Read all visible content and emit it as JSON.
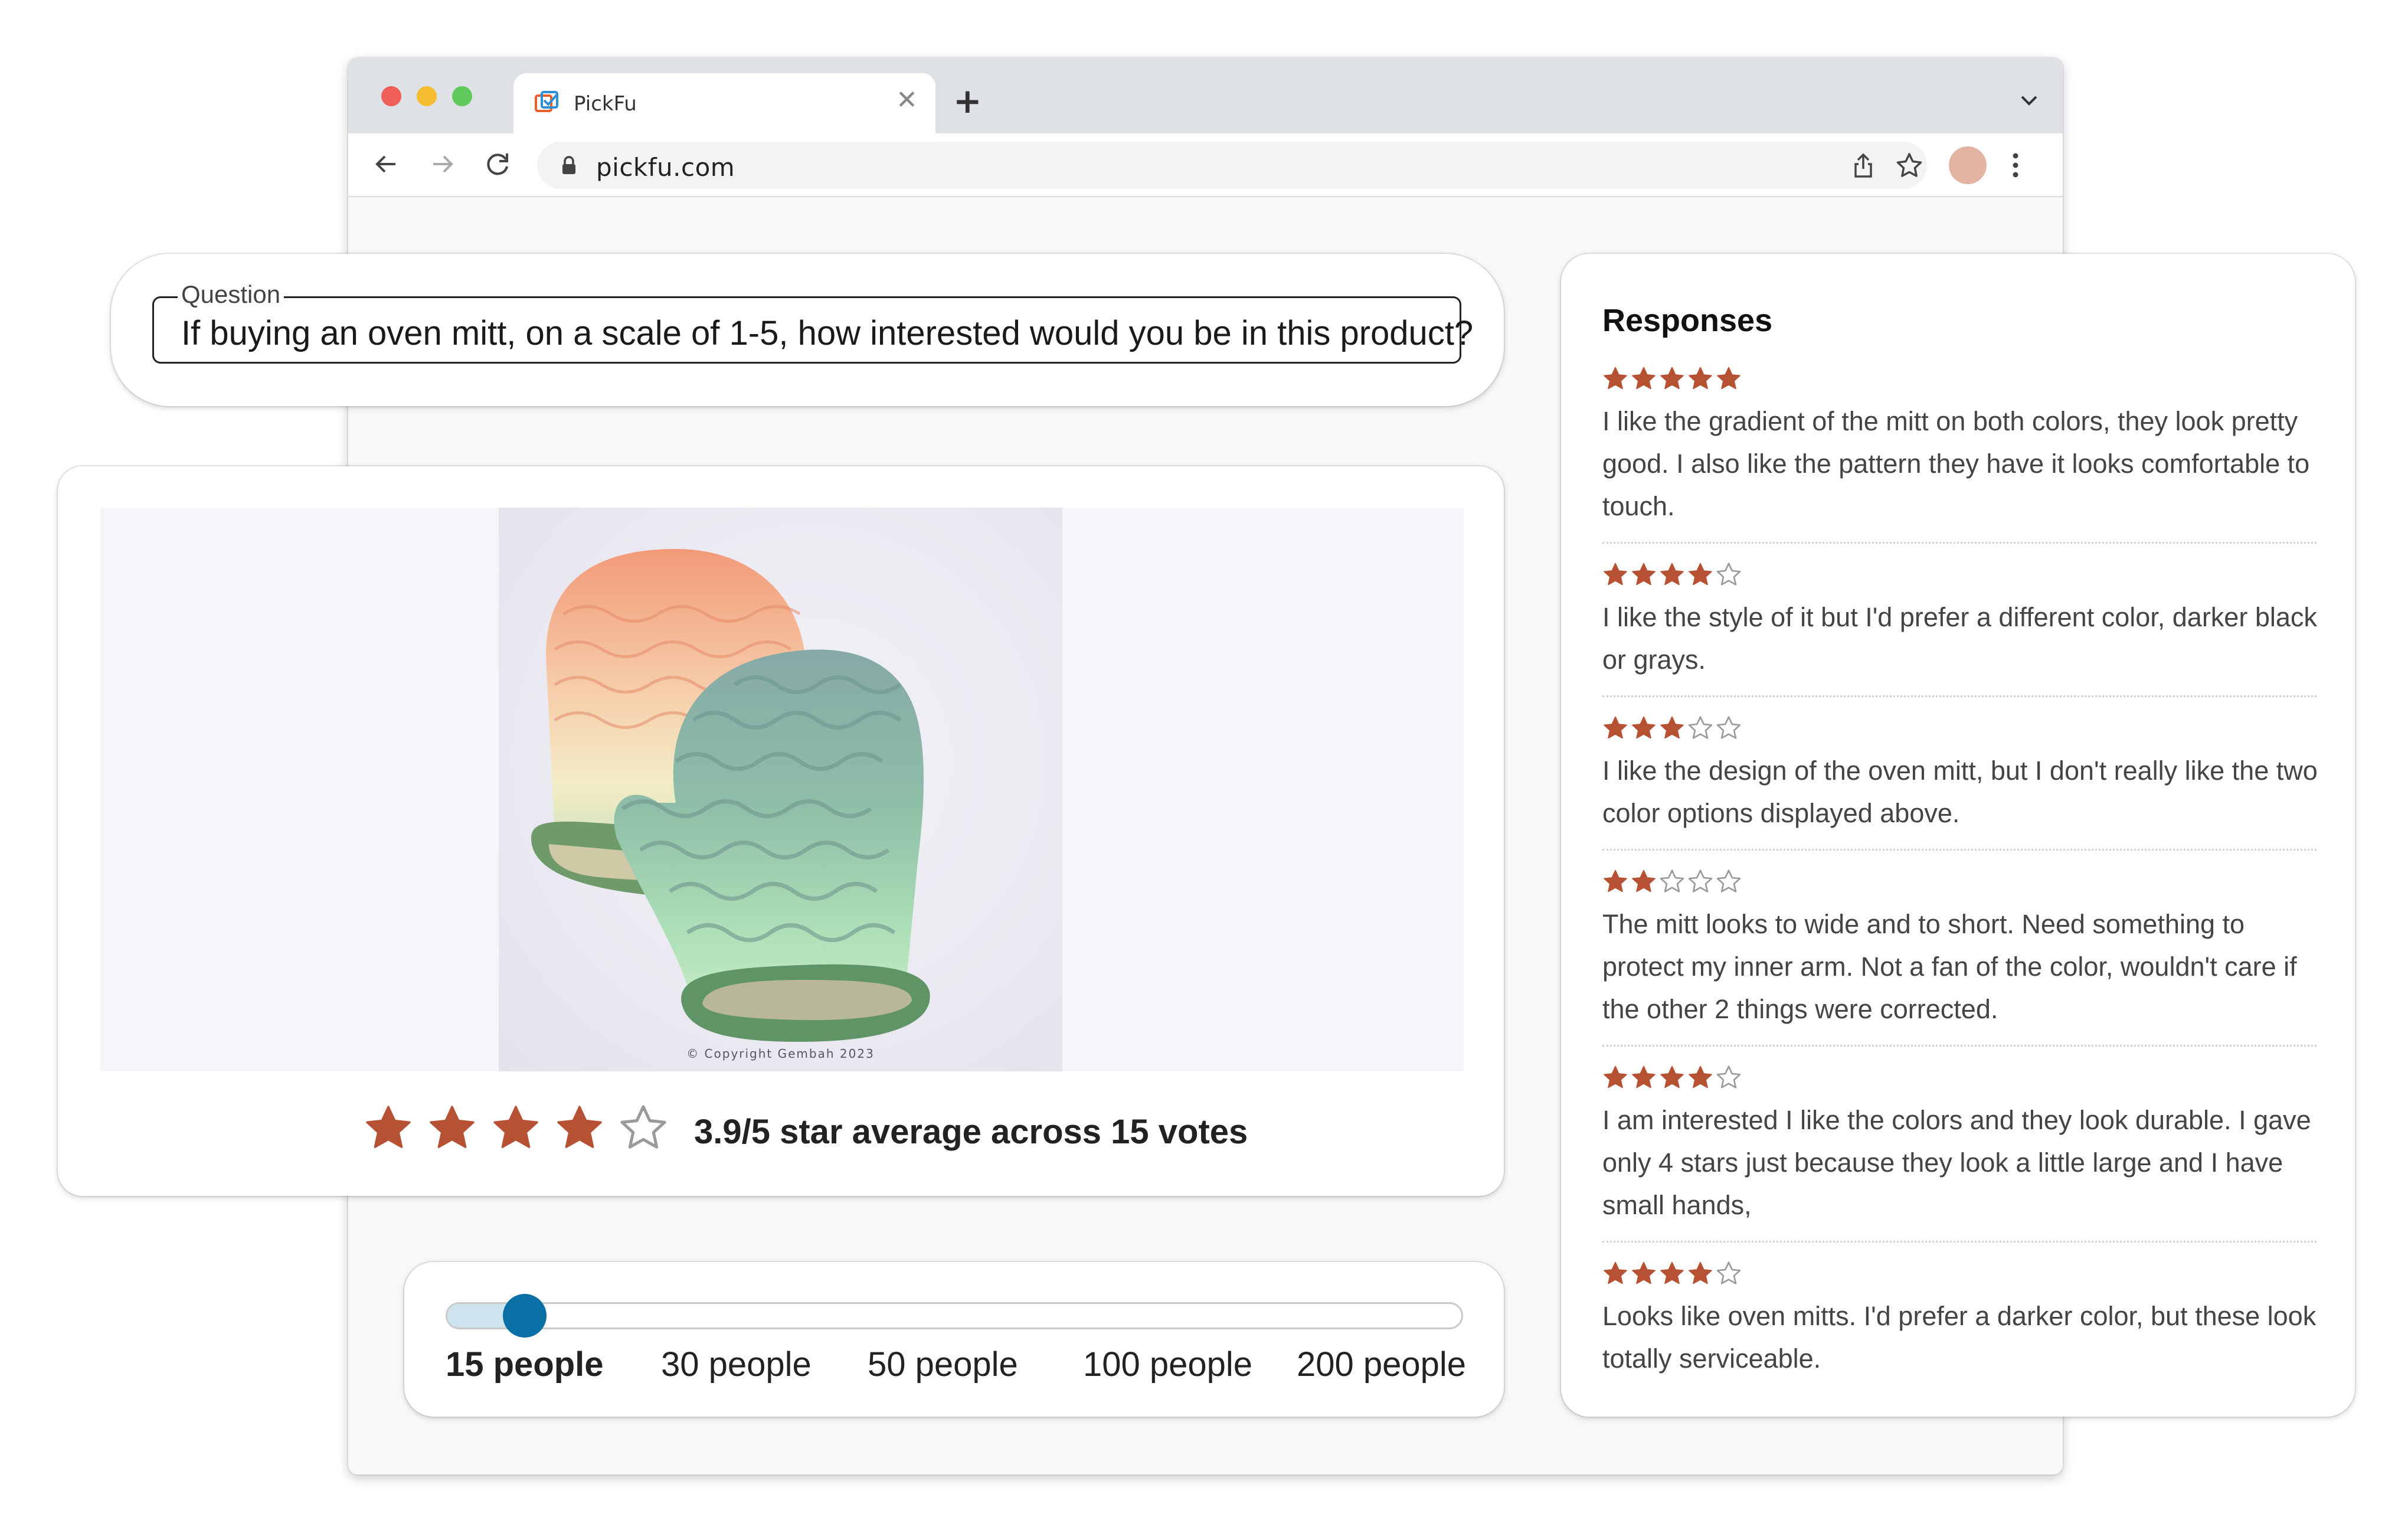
{
  "browser": {
    "tab_title": "PickFu",
    "url": "pickfu.com"
  },
  "question": {
    "label": "Question",
    "text": "If buying an oven mitt, on a scale of 1-5, how interested would you be in this product?"
  },
  "product": {
    "image_copyright": "© Copyright Gembah 2023",
    "rating_stars_filled": 4,
    "rating_stars_total": 5,
    "rating_summary": "3.9/5 star average across 15 votes"
  },
  "audience": {
    "options": [
      "15 people",
      "30 people",
      "50 people",
      "100 people",
      "200 people"
    ],
    "selected_index": 0
  },
  "responses": {
    "title": "Responses",
    "items": [
      {
        "stars": 5,
        "text": "I like the gradient of the mitt on both colors, they look pretty good. I also like the pattern they have it looks comfortable to touch."
      },
      {
        "stars": 4,
        "text": "I like the style of it but I'd prefer a different color, darker black or grays."
      },
      {
        "stars": 3,
        "text": "I like the design of the oven mitt, but I don't really like the two color options displayed above."
      },
      {
        "stars": 2,
        "text": "The mitt looks to wide and to short. Need something to protect my inner arm. Not a fan of the color, wouldn't care if the other 2 things were corrected."
      },
      {
        "stars": 4,
        "text": "I am interested I like the colors and they look durable. I gave only 4 stars just because they look a little large and I have small hands,"
      },
      {
        "stars": 4,
        "text": "Looks like oven mitts. I'd prefer a darker color, but these look totally serviceable."
      }
    ]
  },
  "colors": {
    "star_fill": "#b65233",
    "star_empty_stroke": "#9a9a9a",
    "slider_thumb": "#0a6fa5",
    "slider_fill": "#cde3ee",
    "avatar": "#e2b4a1"
  },
  "icons": {
    "back": "arrow-left-icon",
    "forward": "arrow-right-icon",
    "reload": "reload-icon",
    "lock": "lock-icon",
    "share": "share-icon",
    "bookmark": "star-outline-icon",
    "menu": "kebab-menu-icon",
    "new_tab": "plus-icon",
    "close_tab": "close-icon",
    "tab_list": "chevron-down-icon"
  }
}
